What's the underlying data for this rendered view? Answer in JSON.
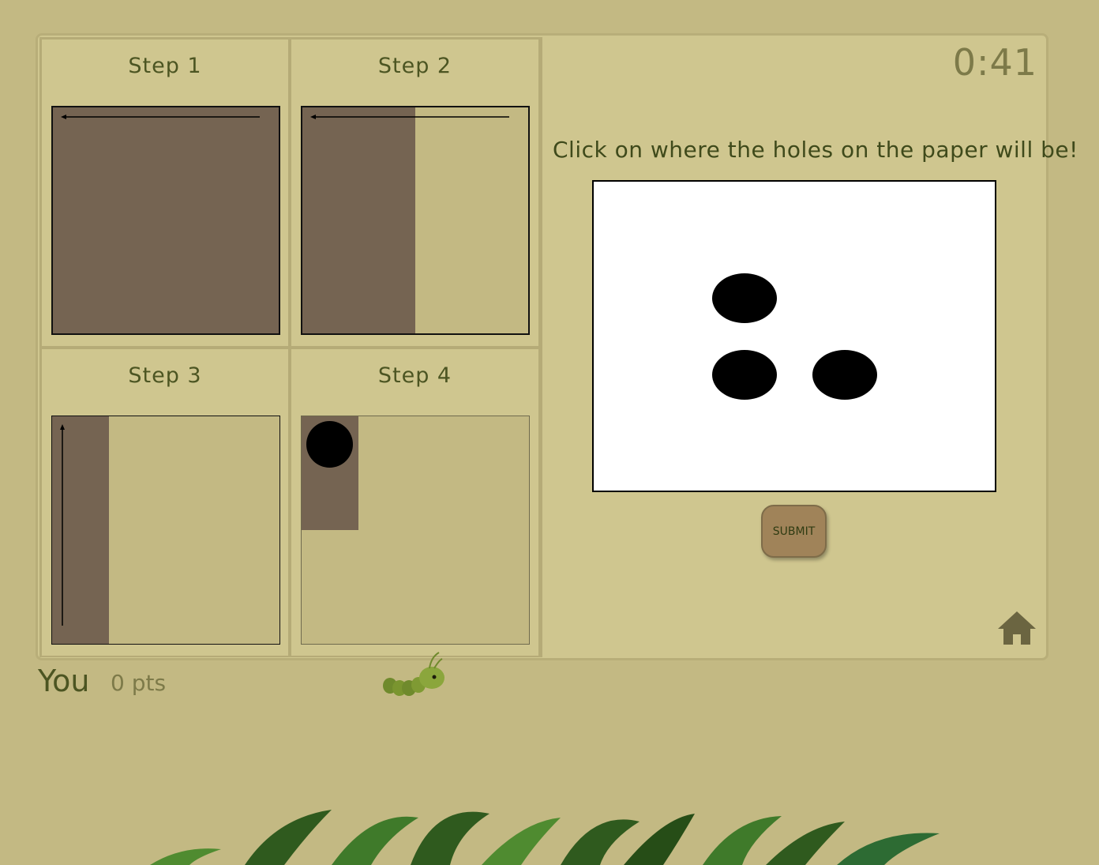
{
  "timer": "0:41",
  "instruction": "Click on where the holes on the paper will be!",
  "steps": [
    {
      "label": "Step 1"
    },
    {
      "label": "Step 2"
    },
    {
      "label": "Step 3"
    },
    {
      "label": "Step 4"
    }
  ],
  "submit_label": "SUBMIT",
  "player": {
    "name": "You",
    "points": "0 pts"
  },
  "colors": {
    "background": "#c3b983",
    "panel": "#cfc68f",
    "paper_brown": "#756452",
    "text_dark_green": "#4c5522",
    "submit_button": "#a08359"
  },
  "icons": [
    "home-icon",
    "caterpillar-mascot",
    "jungle-foliage-decoration"
  ]
}
